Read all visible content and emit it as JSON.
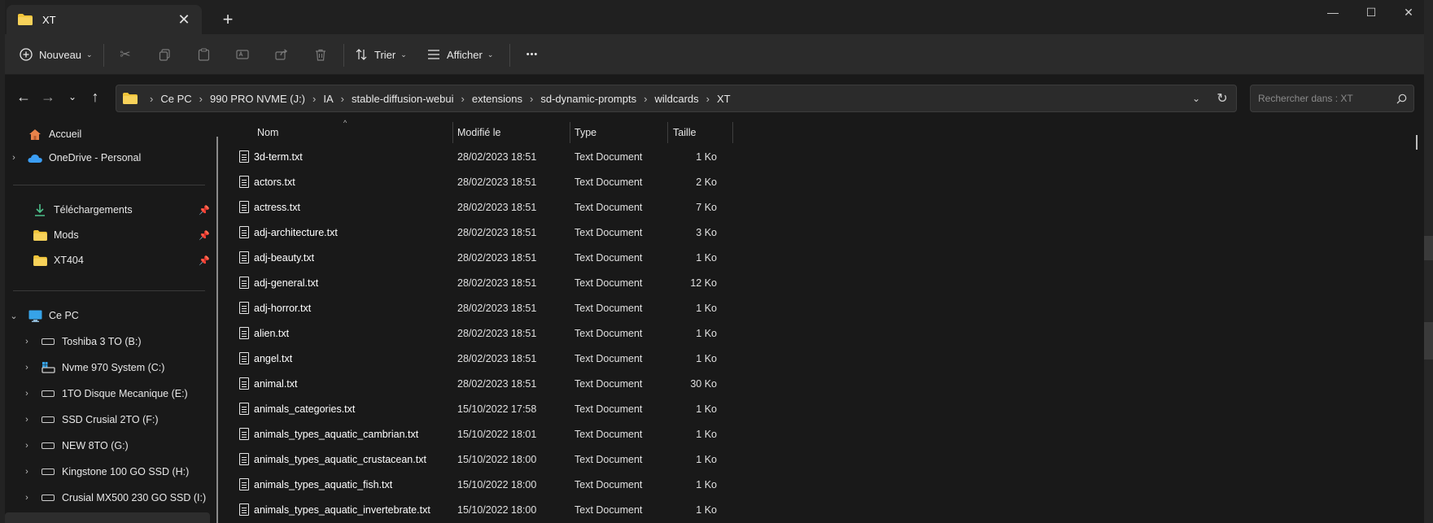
{
  "window": {
    "tab_title": "XT",
    "new_tab_symbol": "+",
    "controls": {
      "minimize": "—",
      "maximize": "☐",
      "close": "✕"
    }
  },
  "toolbar": {
    "new_label": "Nouveau",
    "sort_label": "Trier",
    "view_label": "Afficher",
    "more_label": "•••"
  },
  "address": {
    "crumbs": [
      "Ce PC",
      "990 PRO NVME (J:)",
      "IA",
      "stable-diffusion-webui",
      "extensions",
      "sd-dynamic-prompts",
      "wildcards",
      "XT"
    ]
  },
  "search": {
    "placeholder": "Rechercher dans : XT"
  },
  "sidebar": {
    "home": "Accueil",
    "onedrive": "OneDrive - Personal",
    "pinned": [
      "Téléchargements",
      "Mods",
      "XT404"
    ],
    "this_pc": "Ce PC",
    "drives": [
      "Toshiba 3 TO (B:)",
      "Nvme 970 System (C:)",
      "1TO Disque Mecanique (E:)",
      "SSD Crusial 2TO (F:)",
      "NEW 8TO (G:)",
      "Kingstone 100 GO SSD (H:)",
      "Crusial MX500 230 GO SSD (I:)"
    ]
  },
  "columns": {
    "name": "Nom",
    "modified": "Modifié le",
    "type": "Type",
    "size": "Taille"
  },
  "files": [
    {
      "name": "3d-term.txt",
      "modified": "28/02/2023 18:51",
      "type": "Text Document",
      "size": "1 Ko"
    },
    {
      "name": "actors.txt",
      "modified": "28/02/2023 18:51",
      "type": "Text Document",
      "size": "2 Ko"
    },
    {
      "name": "actress.txt",
      "modified": "28/02/2023 18:51",
      "type": "Text Document",
      "size": "7 Ko"
    },
    {
      "name": "adj-architecture.txt",
      "modified": "28/02/2023 18:51",
      "type": "Text Document",
      "size": "3 Ko"
    },
    {
      "name": "adj-beauty.txt",
      "modified": "28/02/2023 18:51",
      "type": "Text Document",
      "size": "1 Ko"
    },
    {
      "name": "adj-general.txt",
      "modified": "28/02/2023 18:51",
      "type": "Text Document",
      "size": "12 Ko"
    },
    {
      "name": "adj-horror.txt",
      "modified": "28/02/2023 18:51",
      "type": "Text Document",
      "size": "1 Ko"
    },
    {
      "name": "alien.txt",
      "modified": "28/02/2023 18:51",
      "type": "Text Document",
      "size": "1 Ko"
    },
    {
      "name": "angel.txt",
      "modified": "28/02/2023 18:51",
      "type": "Text Document",
      "size": "1 Ko"
    },
    {
      "name": "animal.txt",
      "modified": "28/02/2023 18:51",
      "type": "Text Document",
      "size": "30 Ko"
    },
    {
      "name": "animals_categories.txt",
      "modified": "15/10/2022 17:58",
      "type": "Text Document",
      "size": "1 Ko"
    },
    {
      "name": "animals_types_aquatic_cambrian.txt",
      "modified": "15/10/2022 18:01",
      "type": "Text Document",
      "size": "1 Ko"
    },
    {
      "name": "animals_types_aquatic_crustacean.txt",
      "modified": "15/10/2022 18:00",
      "type": "Text Document",
      "size": "1 Ko"
    },
    {
      "name": "animals_types_aquatic_fish.txt",
      "modified": "15/10/2022 18:00",
      "type": "Text Document",
      "size": "1 Ko"
    },
    {
      "name": "animals_types_aquatic_invertebrate.txt",
      "modified": "15/10/2022 18:00",
      "type": "Text Document",
      "size": "1 Ko"
    }
  ],
  "colors": {
    "folder": "#f0c43a",
    "onedrive": "#3b9ef5",
    "download": "#4cc08a",
    "pc": "#36a3e8",
    "home": "#e8824a"
  }
}
